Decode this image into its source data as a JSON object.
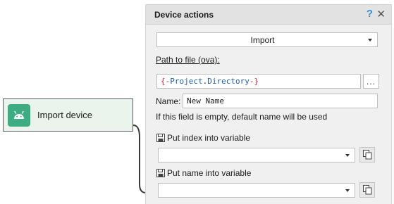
{
  "node": {
    "icon": "android-icon",
    "label": "Import device",
    "icon_color": "#3dac82",
    "background": "#eaf4ec"
  },
  "panel": {
    "title": "Device actions",
    "help_glyph": "?",
    "close_glyph": "✕",
    "action_select": {
      "value": "Import"
    },
    "path_label": "Path to file (ova):",
    "path_value": "{-Project.Directory-}",
    "browse_label": "...",
    "name_label": "Name:",
    "name_value": "New Name",
    "name_hint": "If this field is empty, default name will be used",
    "index_var_label": "Put index into variable",
    "name_var_label": "Put name into variable",
    "accent_colors": {
      "brace": "#cc2222",
      "project": "#1a5fb4",
      "dot": "#222222"
    }
  }
}
